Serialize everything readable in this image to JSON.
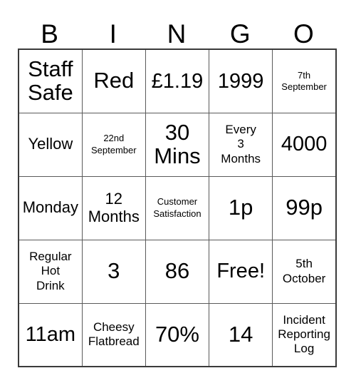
{
  "card": {
    "headers": [
      "B",
      "I",
      "N",
      "G",
      "O"
    ],
    "rows": [
      [
        {
          "text": "Staff\nSafe",
          "size": "xl"
        },
        {
          "text": "Red",
          "size": "xl"
        },
        {
          "text": "£1.19",
          "size": "lg"
        },
        {
          "text": "1999",
          "size": "lg"
        },
        {
          "text": "7th\nSeptember",
          "size": "xs"
        }
      ],
      [
        {
          "text": "Yellow",
          "size": "md"
        },
        {
          "text": "22nd\nSeptember",
          "size": "xs"
        },
        {
          "text": "30\nMins",
          "size": "xl"
        },
        {
          "text": "Every\n3\nMonths",
          "size": "sm"
        },
        {
          "text": "4000",
          "size": "lg"
        }
      ],
      [
        {
          "text": "Monday",
          "size": "md"
        },
        {
          "text": "12\nMonths",
          "size": "md"
        },
        {
          "text": "Customer\nSatisfaction",
          "size": "xs"
        },
        {
          "text": "1p",
          "size": "xl"
        },
        {
          "text": "99p",
          "size": "xl"
        }
      ],
      [
        {
          "text": "Regular\nHot\nDrink",
          "size": "sm"
        },
        {
          "text": "3",
          "size": "xl"
        },
        {
          "text": "86",
          "size": "xl"
        },
        {
          "text": "Free!",
          "size": "lg"
        },
        {
          "text": "5th\nOctober",
          "size": "sm"
        }
      ],
      [
        {
          "text": "11am",
          "size": "lg"
        },
        {
          "text": "Cheesy\nFlatbread",
          "size": "sm"
        },
        {
          "text": "70%",
          "size": "xl"
        },
        {
          "text": "14",
          "size": "xl"
        },
        {
          "text": "Incident\nReporting\nLog",
          "size": "sm"
        }
      ]
    ]
  },
  "colors": {
    "background": "#ffffff",
    "text": "#000000",
    "grid_line": "#5a5a5a",
    "grid_outline": "#3a3a3a"
  }
}
